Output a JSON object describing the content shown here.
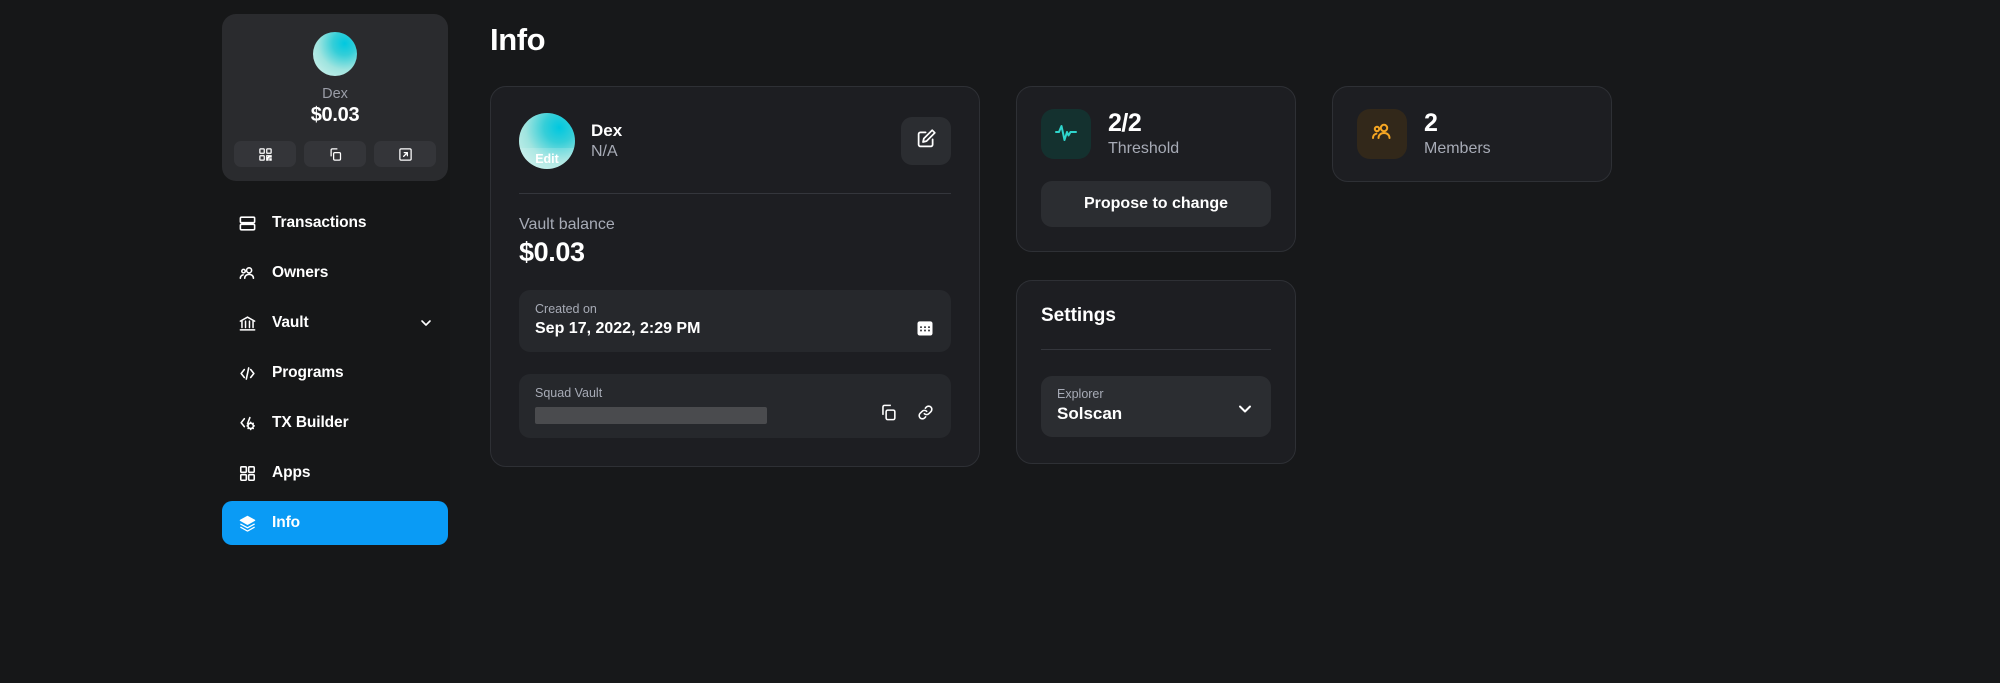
{
  "sidebar": {
    "vault_card": {
      "avatar": "vault-avatar",
      "name": "Dex",
      "amount": "$0.03",
      "actions": [
        {
          "name": "qr-code-icon",
          "label": "QR code"
        },
        {
          "name": "copy-icon",
          "label": "Copy address"
        },
        {
          "name": "external-link-icon",
          "label": "Open in explorer"
        }
      ]
    },
    "nav": [
      {
        "label": "Transactions",
        "icon": "rows-icon",
        "active": false,
        "chevron": false
      },
      {
        "label": "Owners",
        "icon": "people-icon",
        "active": false,
        "chevron": false
      },
      {
        "label": "Vault",
        "icon": "bank-icon",
        "active": false,
        "chevron": true
      },
      {
        "label": "Programs",
        "icon": "code-icon",
        "active": false,
        "chevron": false
      },
      {
        "label": "TX Builder",
        "icon": "code-gear-icon",
        "active": false,
        "chevron": false
      },
      {
        "label": "Apps",
        "icon": "grid-icon",
        "active": false,
        "chevron": false
      },
      {
        "label": "Info",
        "icon": "layers-icon",
        "active": true,
        "chevron": false
      }
    ]
  },
  "main": {
    "page_title": "Info",
    "info_card": {
      "avatar_edit_label": "Edit",
      "name": "Dex",
      "subtitle": "N/A",
      "edit_button": "edit-icon",
      "balance_label": "Vault balance",
      "balance_value": "$0.03",
      "created": {
        "label": "Created on",
        "value": "Sep 17, 2022, 2:29 PM",
        "icon": "calendar-icon"
      },
      "squad_vault": {
        "label": "Squad Vault",
        "value": "",
        "copy_icon": "copy-icon",
        "link_icon": "link-icon"
      }
    },
    "threshold_card": {
      "icon": "activity-pulse-icon",
      "value": "2/2",
      "label": "Threshold",
      "button_label": "Propose to change"
    },
    "members_card": {
      "icon": "members-icon",
      "value": "2",
      "label": "Members"
    },
    "settings_card": {
      "title": "Settings",
      "explorer": {
        "label": "Explorer",
        "value": "Solscan",
        "chevron": "chevron-down-icon"
      }
    }
  },
  "colors": {
    "accent_blue": "#0a9bf5",
    "teal": "#2fd5cc",
    "amber": "#f5a623",
    "page_bg": "#17181a",
    "card_bg": "#1d1e22"
  }
}
